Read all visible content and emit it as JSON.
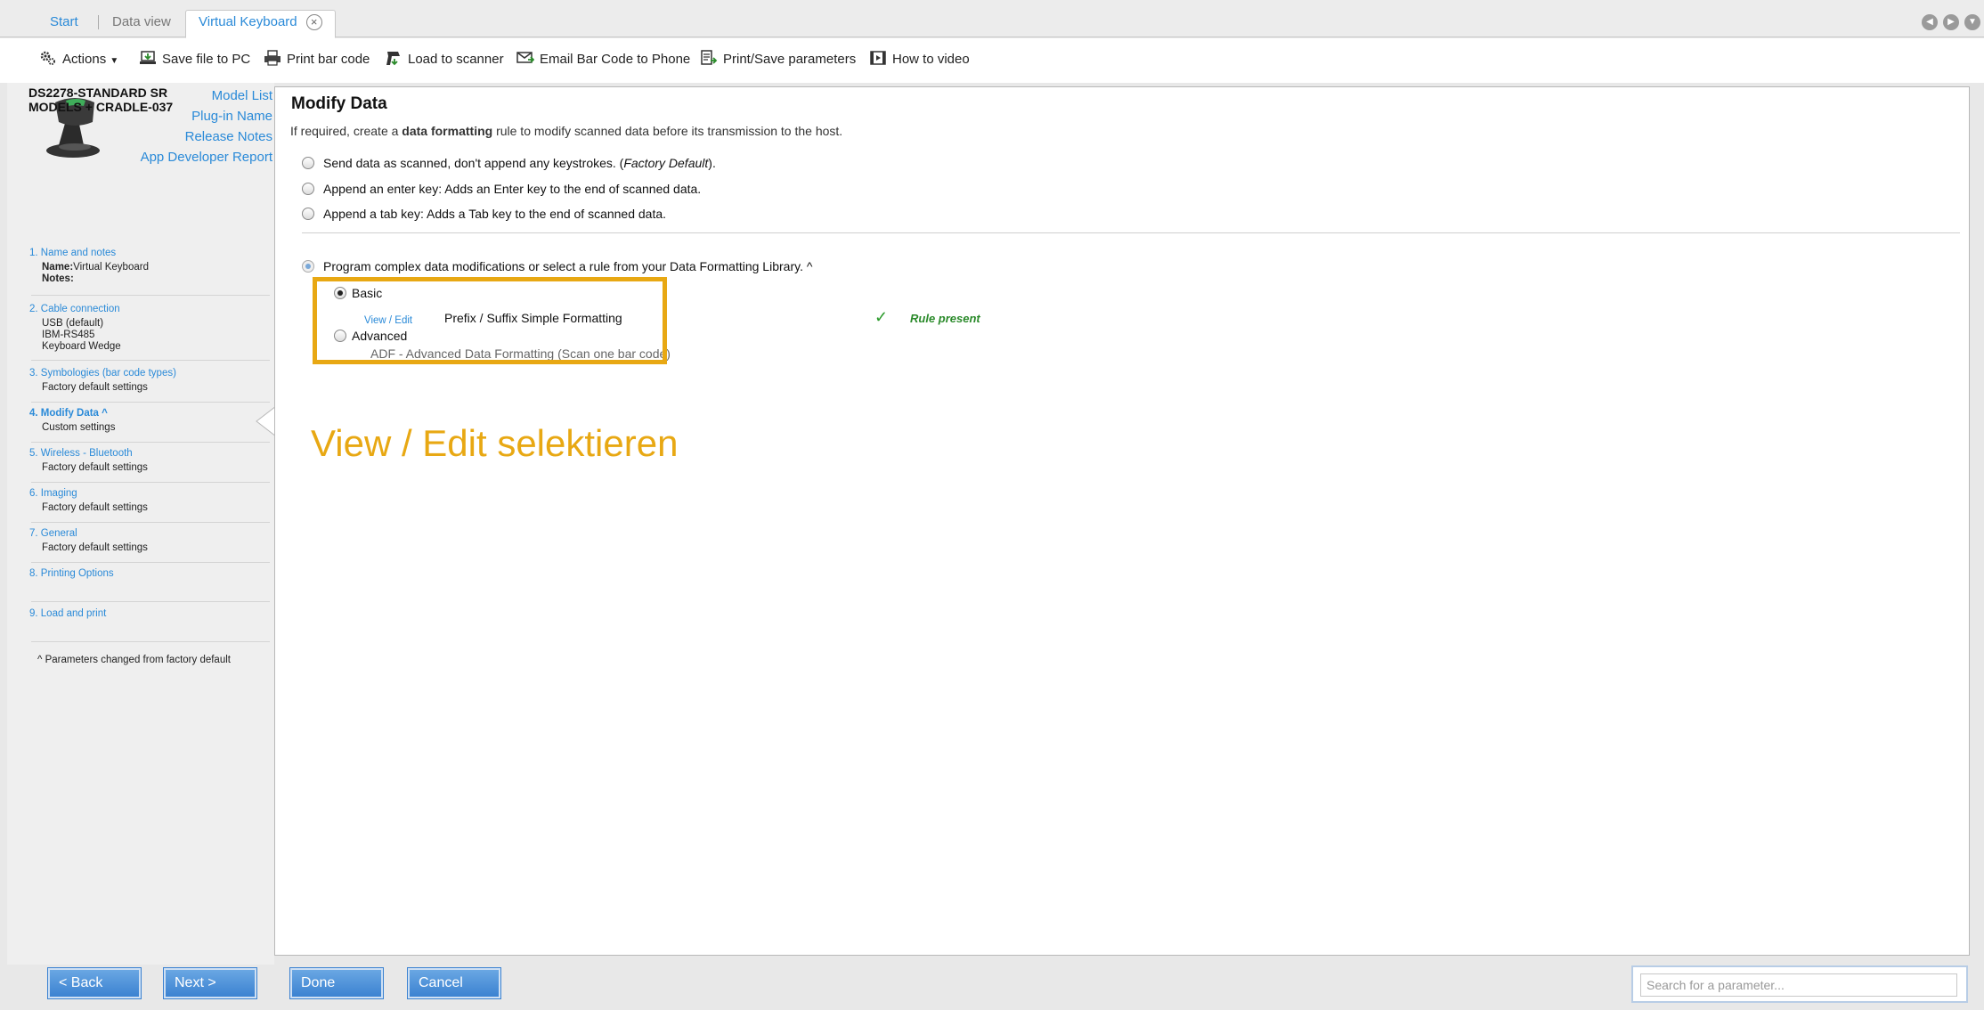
{
  "tabs": [
    {
      "label": "Start"
    },
    {
      "label": "Data view"
    },
    {
      "label": "Virtual Keyboard",
      "close": "⊗"
    }
  ],
  "toolbar": {
    "actions": "Actions",
    "save": "Save file to PC",
    "print_bar_code": "Print bar code",
    "load": "Load to scanner",
    "email": "Email Bar Code to Phone",
    "print_save": "Print/Save parameters",
    "how_to": "How to video"
  },
  "sidebar": {
    "links": [
      "Model List",
      "Plug-in Name",
      "Release Notes",
      "App Developer Report"
    ],
    "model_line1": "DS2278-STANDARD SR",
    "model_line2": "MODELS + CRADLE-037",
    "steps": [
      {
        "title": "1.  Name and notes",
        "name_label": "Name:",
        "name_value": "Virtual Keyboard",
        "notes_label": "Notes:"
      },
      {
        "title": "2.  Cable connection",
        "lines": [
          "USB (default)",
          "IBM-RS485",
          "Keyboard Wedge"
        ]
      },
      {
        "title": "3.  Symbologies (bar code types)",
        "lines": [
          "Factory default settings"
        ]
      },
      {
        "title": "4.  Modify Data ^",
        "lines": [
          "Custom settings"
        ]
      },
      {
        "title": "5.  Wireless - Bluetooth",
        "lines": [
          "Factory default settings"
        ]
      },
      {
        "title": "6.  Imaging",
        "lines": [
          "Factory default settings"
        ]
      },
      {
        "title": "7.  General",
        "lines": [
          "Factory default settings"
        ]
      },
      {
        "title": "8.  Printing Options"
      },
      {
        "title": "9.  Load and print"
      }
    ],
    "footnote": "^  Parameters changed from factory default"
  },
  "main": {
    "title": "Modify Data",
    "desc_pre": "If required, create a ",
    "desc_bold": "data formatting",
    "desc_post": " rule to modify scanned data before its transmission to the host.",
    "opt1_pre": "Send data as scanned, don't append any keystrokes. (",
    "opt1_em": "Factory Default",
    "opt1_post": ").",
    "opt2": "Append an enter key: Adds an Enter key to the end of scanned data.",
    "opt3": "Append a tab key: Adds a Tab key to the end of scanned data.",
    "opt4": "Program complex data modifications or select a rule from your Data Formatting Library.  ^",
    "basic": "Basic",
    "view_edit": "View / Edit",
    "rule_name": "Prefix / Suffix Simple Formatting",
    "rule_present": "Rule present",
    "advanced": "Advanced",
    "adf": "ADF - Advanced Data Formatting (Scan one bar code)",
    "annotation": "View / Edit selektieren",
    "highlight_color": "#e8a813"
  },
  "bottom": {
    "back": "< Back",
    "next": "Next >",
    "done": "Done",
    "cancel": "Cancel",
    "search_placeholder": "Search for a parameter..."
  }
}
